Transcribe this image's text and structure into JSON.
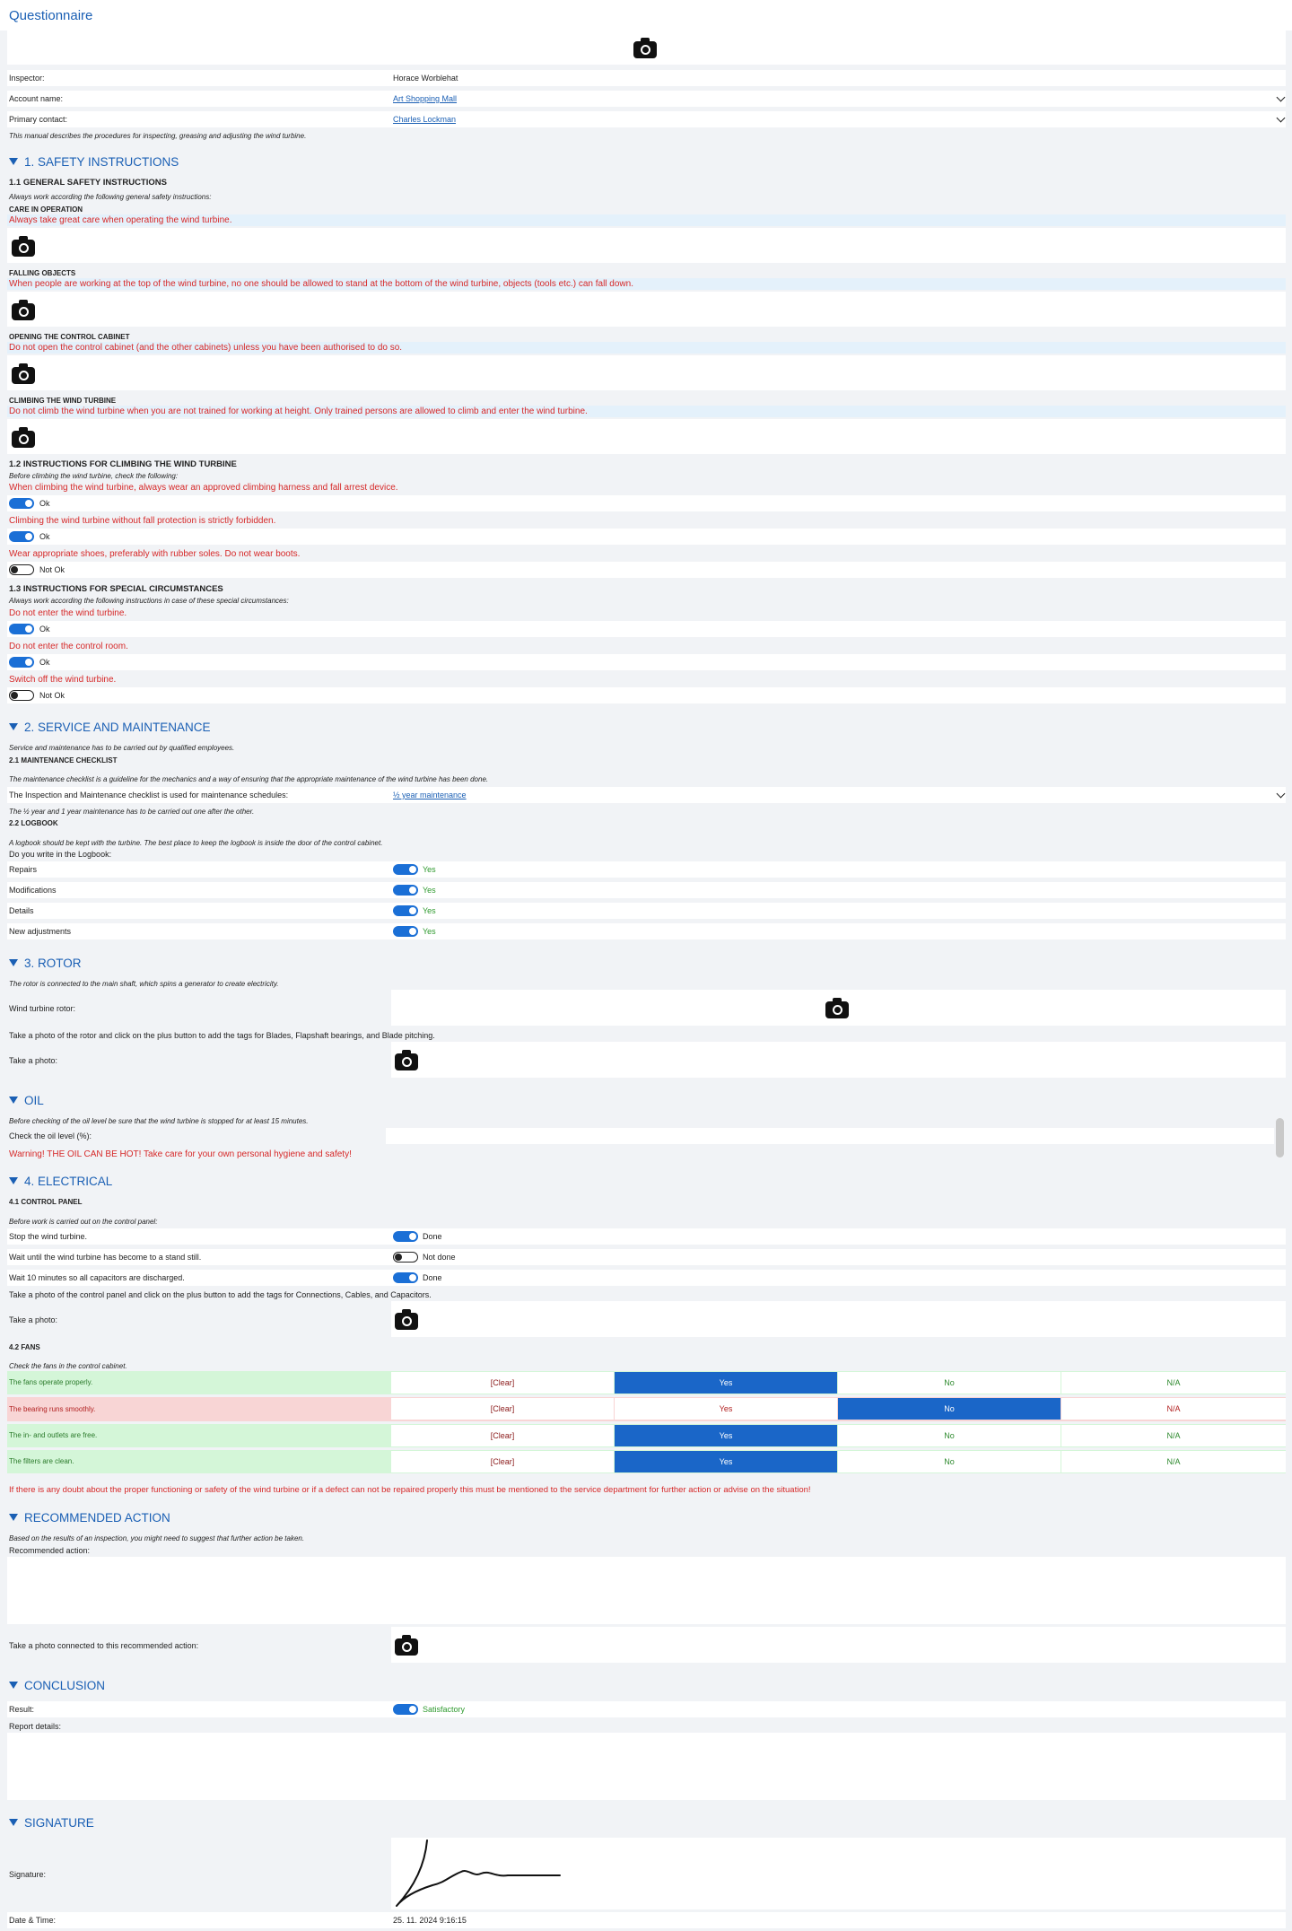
{
  "app": {
    "title": "Questionnaire"
  },
  "icons": {
    "camera": "camera-icon"
  },
  "header": {
    "inspector_label": "Inspector:",
    "inspector_value": "Horace Worblehat",
    "account_label": "Account name:",
    "account_value": "Art Shopping Mall",
    "contact_label": "Primary contact:",
    "contact_value": "Charles Lockman",
    "intro": "This manual describes the procedures for inspecting, greasing and adjusting the wind turbine."
  },
  "s1": {
    "title": "1. SAFETY INSTRUCTIONS",
    "sub1": "1.1 GENERAL SAFETY INSTRUCTIONS",
    "sub1_note": "Always work according the following general safety instructions:",
    "care_h": "CARE IN OPERATION",
    "care_t": "Always take great care when operating the wind turbine.",
    "fall_h": "FALLING OBJECTS",
    "fall_t": "When people are working at the top of the wind turbine, no one should be allowed to stand at the bottom of the wind turbine, objects (tools etc.) can fall down.",
    "cab_h": "OPENING THE CONTROL CABINET",
    "cab_t": "Do not open the control cabinet (and the other cabinets) unless you have been authorised to do so.",
    "climb_h": "CLIMBING THE WIND TURBINE",
    "climb_t": "Do not climb the wind turbine when you are not trained for working at height. Only trained persons are allowed to climb and enter the wind turbine.",
    "sub2": "1.2 INSTRUCTIONS FOR CLIMBING THE WIND TURBINE",
    "sub2_note": "Before climbing the wind turbine, check the following:",
    "q1": "When climbing the wind turbine, always wear an approved climbing harness and fall arrest device.",
    "a1": "Ok",
    "q2": "Climbing the wind turbine without fall protection is strictly forbidden.",
    "a2": "Ok",
    "q3": "Wear appropriate shoes, preferably with rubber soles. Do not wear boots.",
    "a3": "Not Ok",
    "sub3": "1.3 INSTRUCTIONS FOR SPECIAL CIRCUMSTANCES",
    "sub3_note": "Always work according the following instructions in case of these special circumstances:",
    "q4": "Do not enter the wind turbine.",
    "a4": "Ok",
    "q5": "Do not enter the control room.",
    "a5": "Ok",
    "q6": "Switch off the wind turbine.",
    "a6": "Not Ok"
  },
  "s2": {
    "title": "2. SERVICE AND MAINTENANCE",
    "note": "Service and maintenance has to be carried out by qualified employees.",
    "sub1": "2.1 MAINTENANCE CHECKLIST",
    "sub1_note": "The maintenance checklist is a guideline for the mechanics and a way of ensuring that the appropriate maintenance of the wind turbine has been done.",
    "sched_label": "The Inspection and Maintenance checklist is used for maintenance schedules:",
    "sched_value": "½ year maintenance",
    "sched_note": "The ½ year and 1 year maintenance has to be carried out one after the other.",
    "sub2": "2.2 LOGBOOK",
    "sub2_note": "A logbook should be kept with the turbine. The best place to keep the logbook is inside the door of the control cabinet.",
    "write_q": "Do you write in the Logbook:",
    "items": [
      {
        "label": "Repairs",
        "value": "Yes"
      },
      {
        "label": "Modifications",
        "value": "Yes"
      },
      {
        "label": "Details",
        "value": "Yes"
      },
      {
        "label": "New adjustments",
        "value": "Yes"
      }
    ]
  },
  "s3": {
    "title": "3. ROTOR",
    "note": "The rotor is connected to the main shaft, which spins a generator to create electricity.",
    "rotor_label": "Wind turbine rotor:",
    "photo_note": "Take a photo of the rotor and click on the plus button to add the tags for Blades, Flapshaft bearings, and Blade pitching.",
    "photo_label": "Take a photo:"
  },
  "oil": {
    "title": "OIL",
    "note": "Before checking of the oil level be sure that the wind turbine is stopped for at least 15 minutes.",
    "label": "Check the oil level (%):",
    "warning": "Warning! THE OIL CAN BE HOT! Take care for your own personal hygiene and safety!"
  },
  "s4": {
    "title": "4. ELECTRICAL",
    "sub1": "4.1 CONTROL PANEL",
    "sub1_note": "Before work is carried out on the control panel:",
    "c1": "Stop the wind turbine.",
    "c1v": "Done",
    "c2": "Wait until the wind turbine has become to a stand still.",
    "c2v": "Not done",
    "c3": "Wait 10 minutes so all capacitors are discharged.",
    "c3v": "Done",
    "photo_note": "Take a photo of the control panel and click on the plus button to add the tags for Connections, Cables, and Capacitors.",
    "photo_label": "Take a photo:",
    "sub2": "4.2 FANS",
    "sub2_note": "Check the fans in the control cabinet.",
    "options": {
      "clear": "[Clear]",
      "yes": "Yes",
      "no": "No",
      "na": "N/A"
    },
    "fans": [
      {
        "label": "The fans operate properly.",
        "selected": "yes"
      },
      {
        "label": "The bearing runs smoothly.",
        "selected": "no"
      },
      {
        "label": "The in- and outlets are free.",
        "selected": "yes"
      },
      {
        "label": "The filters are clean.",
        "selected": "yes"
      }
    ],
    "doubt": "If there is any doubt about the proper functioning or safety of the wind turbine or if a defect can not be repaired properly this must be mentioned to the service department for further action or advise on the situation!"
  },
  "rec": {
    "title": "RECOMMENDED ACTION",
    "note": "Based on the results of an inspection, you might need to suggest that further action be taken.",
    "label": "Recommended action:",
    "photo_label": "Take a photo connected to this recommended action:"
  },
  "concl": {
    "title": "CONCLUSION",
    "result_label": "Result:",
    "result_value": "Satisfactory",
    "details_label": "Report details:"
  },
  "sig": {
    "title": "SIGNATURE",
    "label": "Signature:",
    "date_label": "Date & Time:",
    "date_value": "25. 11. 2024 9:16:15"
  }
}
